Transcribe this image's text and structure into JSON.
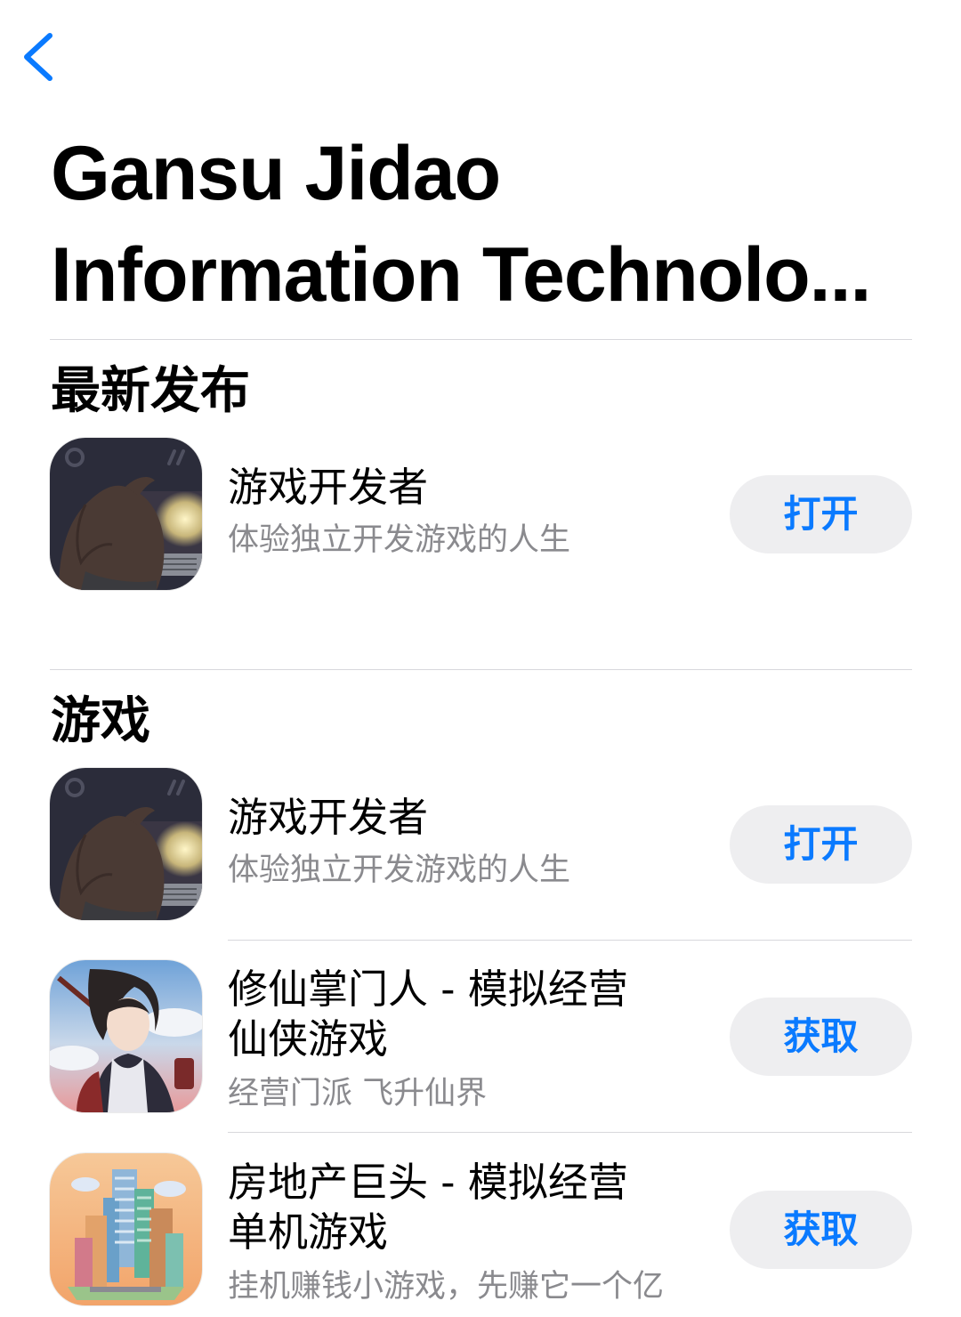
{
  "nav": {
    "back_icon": "chevron-left-icon",
    "accent_color": "#0A7AFF"
  },
  "developer": {
    "title_line1": "Gansu Jidao",
    "title_line2": "Information Technolo..."
  },
  "sections": [
    {
      "title": "最新发布",
      "apps": [
        {
          "name": "游戏开发者",
          "subtitle": "体验独立开发游戏的人生",
          "action": "打开",
          "icon": "game-developer-app-icon"
        }
      ]
    },
    {
      "title": "游戏",
      "apps": [
        {
          "name": "游戏开发者",
          "subtitle": "体验独立开发游戏的人生",
          "action": "打开",
          "icon": "game-developer-app-icon"
        },
        {
          "name_line1": "修仙掌门人 - 模拟经营",
          "name_line2": "仙侠游戏",
          "subtitle": "经营门派 飞升仙界",
          "action": "获取",
          "icon": "xiuxian-app-icon"
        },
        {
          "name_line1": "房地产巨头 - 模拟经营",
          "name_line2": "单机游戏",
          "subtitle": "挂机赚钱小游戏，先赚它一个亿",
          "action": "获取",
          "icon": "real-estate-app-icon"
        }
      ]
    }
  ]
}
